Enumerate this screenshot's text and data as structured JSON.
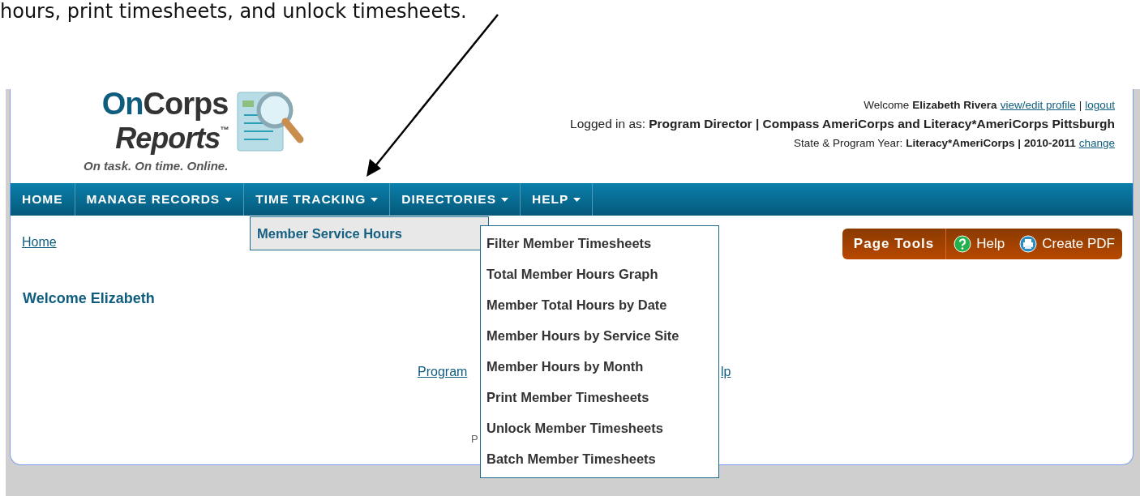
{
  "annotation": {
    "text": "hours, print timesheets, and unlock timesheets."
  },
  "logo": {
    "on": "On",
    "corps": "Corps",
    "reports": "Reports",
    "trademark": "™",
    "tagline": "On task. On time. Online."
  },
  "user_info": {
    "welcome": "Welcome",
    "name": "Elizabeth Rivera",
    "profile_link": "view/edit profile",
    "separator": "|",
    "logout_link": "logout",
    "logged_label": "Logged in as:",
    "logged_value": "Program Director | Compass AmeriCorps and Literacy*AmeriCorps Pittsburgh",
    "year_label": "State & Program Year:",
    "year_value": "Literacy*AmeriCorps | 2010-2011",
    "change_link": "change"
  },
  "nav": [
    {
      "label": "HOME",
      "dropdown": false
    },
    {
      "label": "MANAGE RECORDS",
      "dropdown": true
    },
    {
      "label": "TIME TRACKING",
      "dropdown": true
    },
    {
      "label": "DIRECTORIES",
      "dropdown": true
    },
    {
      "label": "HELP",
      "dropdown": true
    }
  ],
  "menu": [
    {
      "label": "Member Service Hours",
      "highlighted": true
    }
  ],
  "submenu": [
    "Filter Member Timesheets",
    "Total Member Hours Graph",
    "Member Total Hours by Date",
    "Member Hours by Service Site",
    "Member Hours by Month",
    "Print Member Timesheets",
    "Unlock Member Timesheets",
    "Batch Member Timesheets"
  ],
  "breadcrumb": "Home",
  "page_tools": {
    "title": "Page Tools",
    "help": "Help",
    "pdf": "Create PDF"
  },
  "heading": "Welcome Elizabeth",
  "links": {
    "left": "Program",
    "right": "lp"
  },
  "footer_fragment": "P"
}
